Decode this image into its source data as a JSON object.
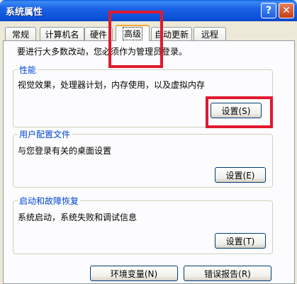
{
  "window": {
    "title": "系统属性",
    "help": "?",
    "close": "✕"
  },
  "tabs": [
    {
      "label": "常规"
    },
    {
      "label": "计算机名"
    },
    {
      "label": "硬件"
    },
    {
      "label": "高级",
      "active": true
    },
    {
      "label": "自动更新"
    },
    {
      "label": "远程"
    }
  ],
  "intro_text": "要进行大多数改动，您必须作为管理员登录。",
  "groups": {
    "performance": {
      "title": "性能",
      "description": "视觉效果，处理器计划，内存使用，以及虚拟内存",
      "button": "设置(S)"
    },
    "user_profiles": {
      "title": "用户配置文件",
      "description": "与您登录有关的桌面设置",
      "button": "设置(E)"
    },
    "startup_recovery": {
      "title": "启动和故障恢复",
      "description": "系统启动，系统失败和调试信息",
      "button": "设置(T)"
    }
  },
  "bottom_buttons": {
    "env_vars": "环境变量(N)",
    "error_report": "错误报告(R)"
  },
  "colors": {
    "highlight": "#e0192e",
    "group_title": "#0046d5",
    "titlebar": "#0b50d8"
  }
}
